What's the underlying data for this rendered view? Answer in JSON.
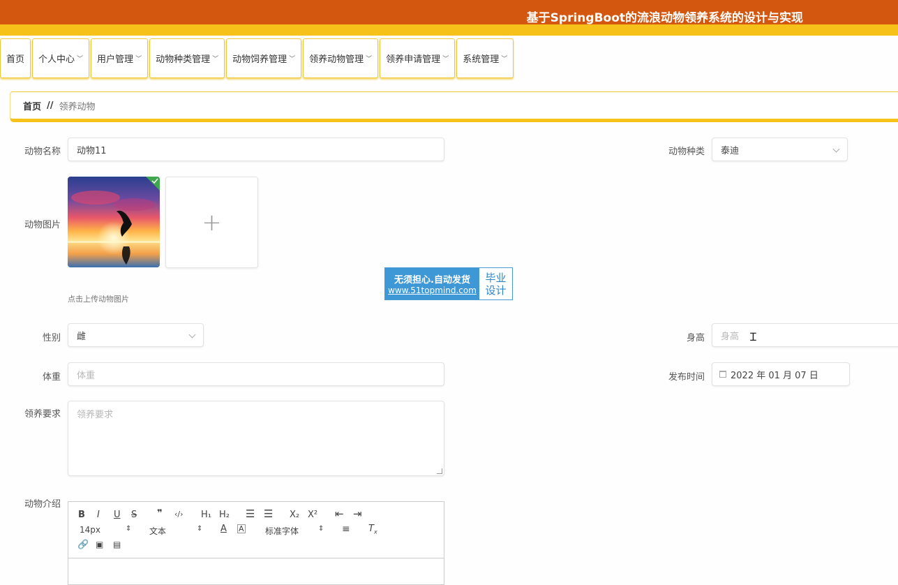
{
  "header": {
    "title": "基于SpringBoot的流浪动物领养系统的设计与实现"
  },
  "nav": {
    "items": [
      {
        "label": "首页",
        "has_menu": false
      },
      {
        "label": "个人中心",
        "has_menu": true
      },
      {
        "label": "用户管理",
        "has_menu": true
      },
      {
        "label": "动物种类管理",
        "has_menu": true
      },
      {
        "label": "动物饲养管理",
        "has_menu": true
      },
      {
        "label": "领养动物管理",
        "has_menu": true
      },
      {
        "label": "领养申请管理",
        "has_menu": true
      },
      {
        "label": "系统管理",
        "has_menu": true
      }
    ]
  },
  "breadcrumb": {
    "home": "首页",
    "separator": "//",
    "current": "领养动物"
  },
  "form": {
    "name": {
      "label": "动物名称",
      "value": "动物11"
    },
    "category": {
      "label": "动物种类",
      "value": "泰迪"
    },
    "image": {
      "label": "动物图片",
      "hint": "点击上传动物图片",
      "add_symbol": "+"
    },
    "gender": {
      "label": "性别",
      "value": "雌"
    },
    "height": {
      "label": "身高",
      "placeholder": "身高"
    },
    "weight": {
      "label": "体重",
      "placeholder": "体重"
    },
    "publish_time": {
      "label": "发布时间",
      "value": "2022 年 01 月 07 日"
    },
    "requirements": {
      "label": "领养要求",
      "placeholder": "领养要求"
    },
    "intro": {
      "label": "动物介绍"
    }
  },
  "editor_toolbar": {
    "row1": [
      "B",
      "I",
      "U",
      "S",
      "❞",
      "‹/›",
      "H₁",
      "H₂",
      "ordered-list",
      "bullet-list",
      "X₂",
      "X²",
      "outdent",
      "indent"
    ],
    "font_size": "14px",
    "heading_select": "文本",
    "font_family": "标准字体"
  },
  "watermark": {
    "line1": "无须担心.自动发货",
    "line2": "www.51topmind.com",
    "right1": "毕业",
    "right2": "设计"
  },
  "colors": {
    "header": "#d4570f",
    "accent": "#f6c21a",
    "check": "#3fa84f"
  }
}
